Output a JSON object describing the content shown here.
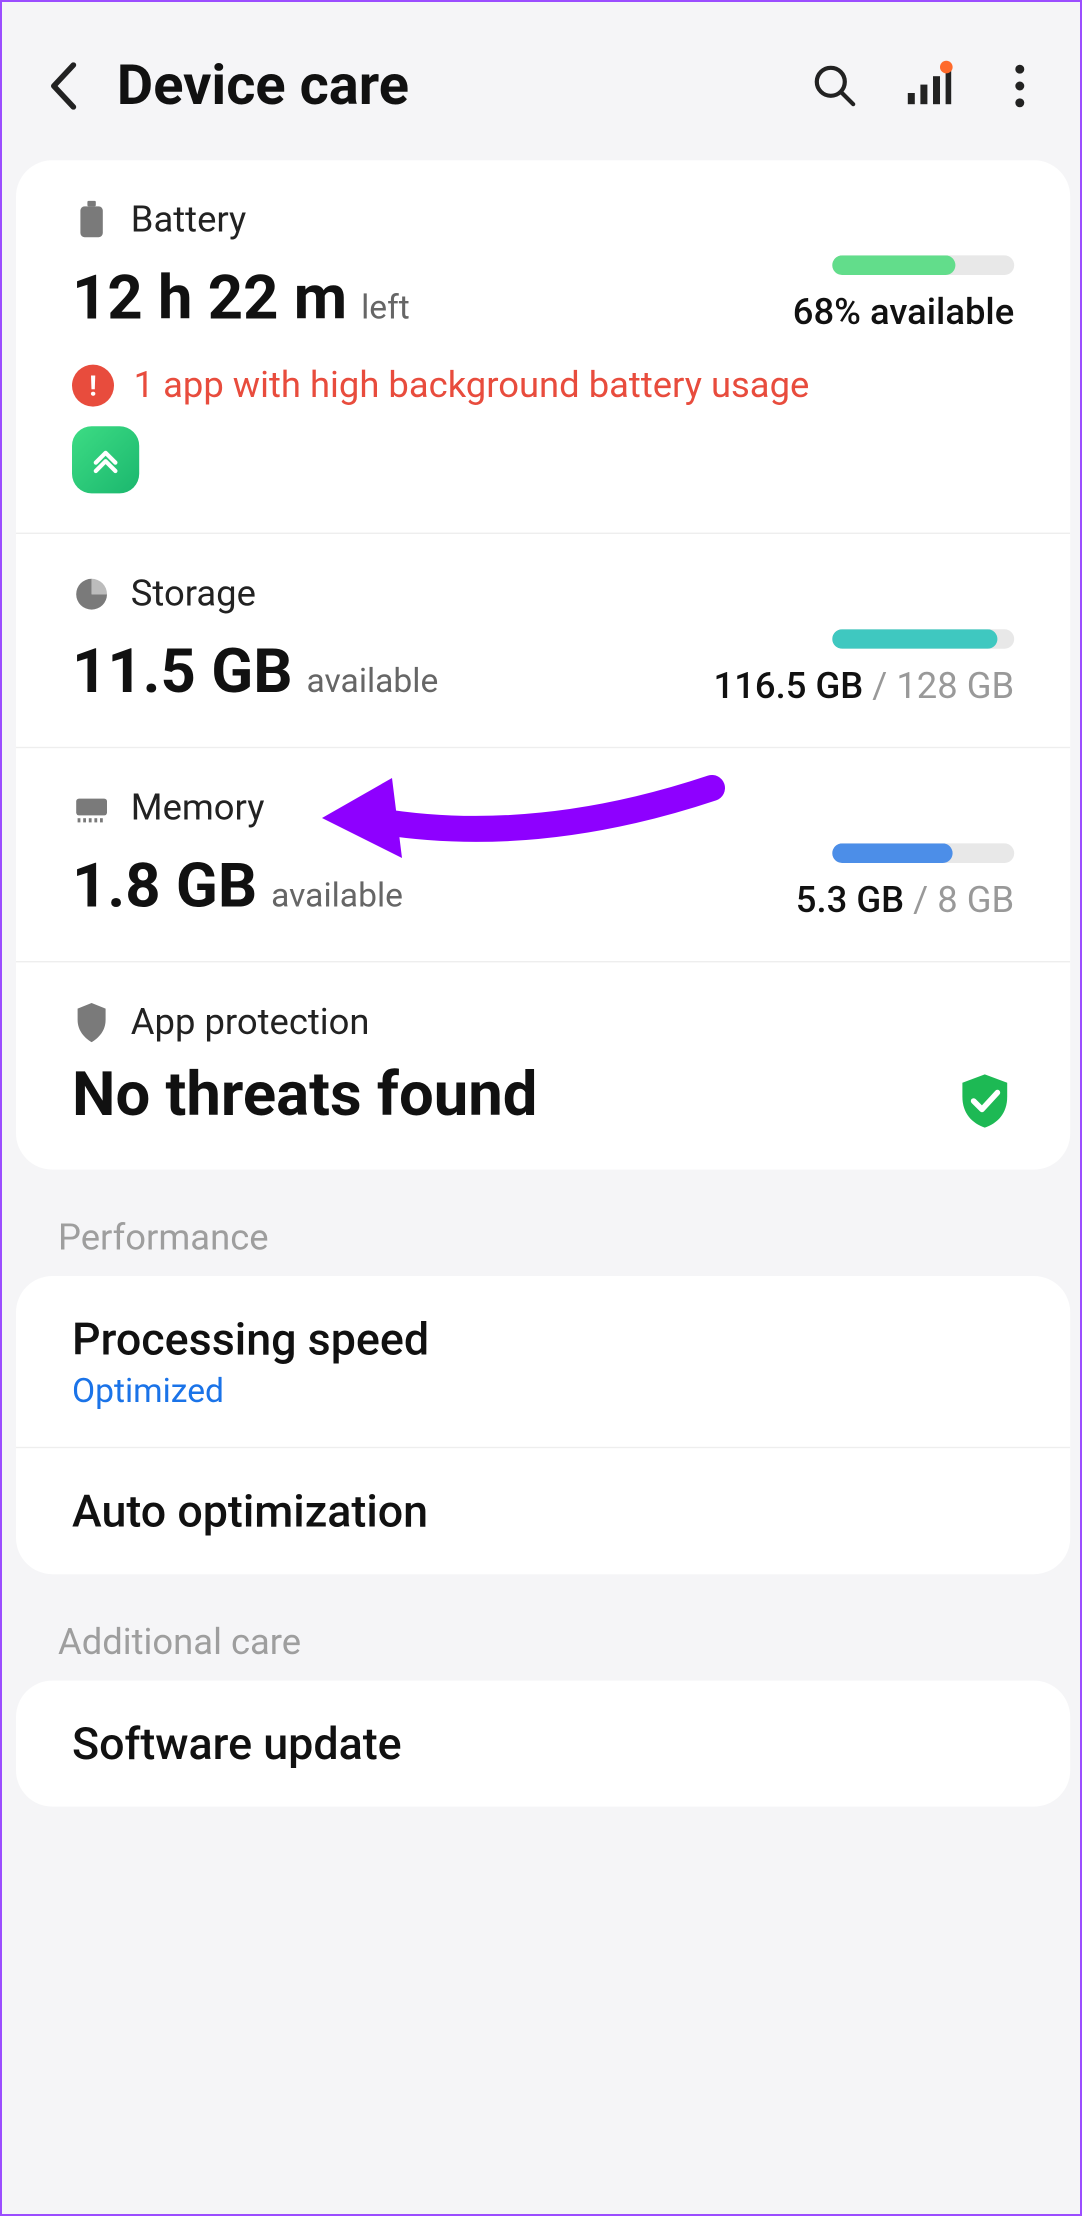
{
  "header": {
    "title": "Device care"
  },
  "battery": {
    "label": "Battery",
    "value": "12 h 22 m",
    "suffix": "left",
    "available": "68% available",
    "bar_color": "#62dd8b",
    "bar_fill_pct": 68,
    "warning": "1 app with high background battery usage"
  },
  "storage": {
    "label": "Storage",
    "value": "11.5 GB",
    "suffix": "available",
    "used": "116.5 GB",
    "total": "/ 128 GB",
    "bar_color": "#3fc8c0",
    "bar_fill_pct": 91
  },
  "memory": {
    "label": "Memory",
    "value": "1.8 GB",
    "suffix": "available",
    "used": "5.3 GB",
    "total": "/ 8 GB",
    "bar_color": "#4c8ee8",
    "bar_fill_pct": 66
  },
  "protection": {
    "label": "App protection",
    "status": "No threats found"
  },
  "performance": {
    "section": "Performance",
    "processing_title": "Processing speed",
    "processing_status": "Optimized",
    "auto_opt": "Auto optimization"
  },
  "additional": {
    "section": "Additional care",
    "software_update": "Software update"
  }
}
